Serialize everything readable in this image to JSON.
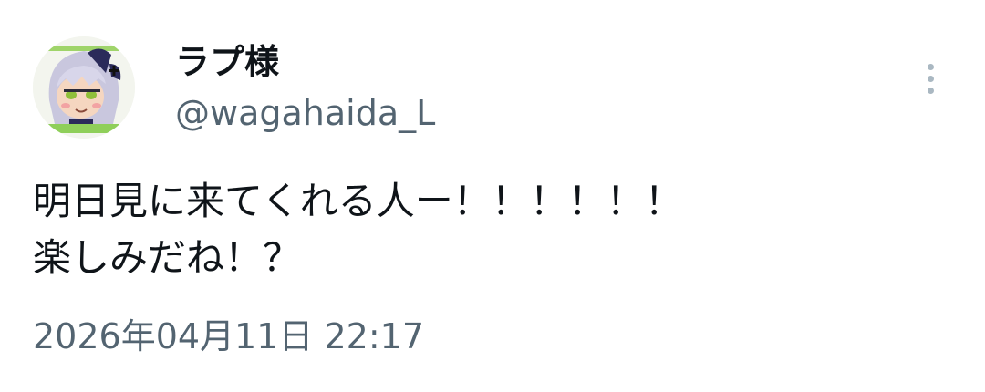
{
  "tweet": {
    "author": {
      "display_name": "ラプ様",
      "handle": "@wagahaida_L",
      "avatar_icon": "character-avatar-icon"
    },
    "more_icon": "more-vertical-icon",
    "text_lines": [
      "明日見に来てくれる人ー！！！！！！",
      "楽しみだね！？"
    ],
    "timestamp": "2026年04月11日 22:17"
  },
  "colors": {
    "primary_text": "#0f1419",
    "secondary_text": "#536471",
    "more_icon": "#aab8c2",
    "background": "#ffffff"
  }
}
